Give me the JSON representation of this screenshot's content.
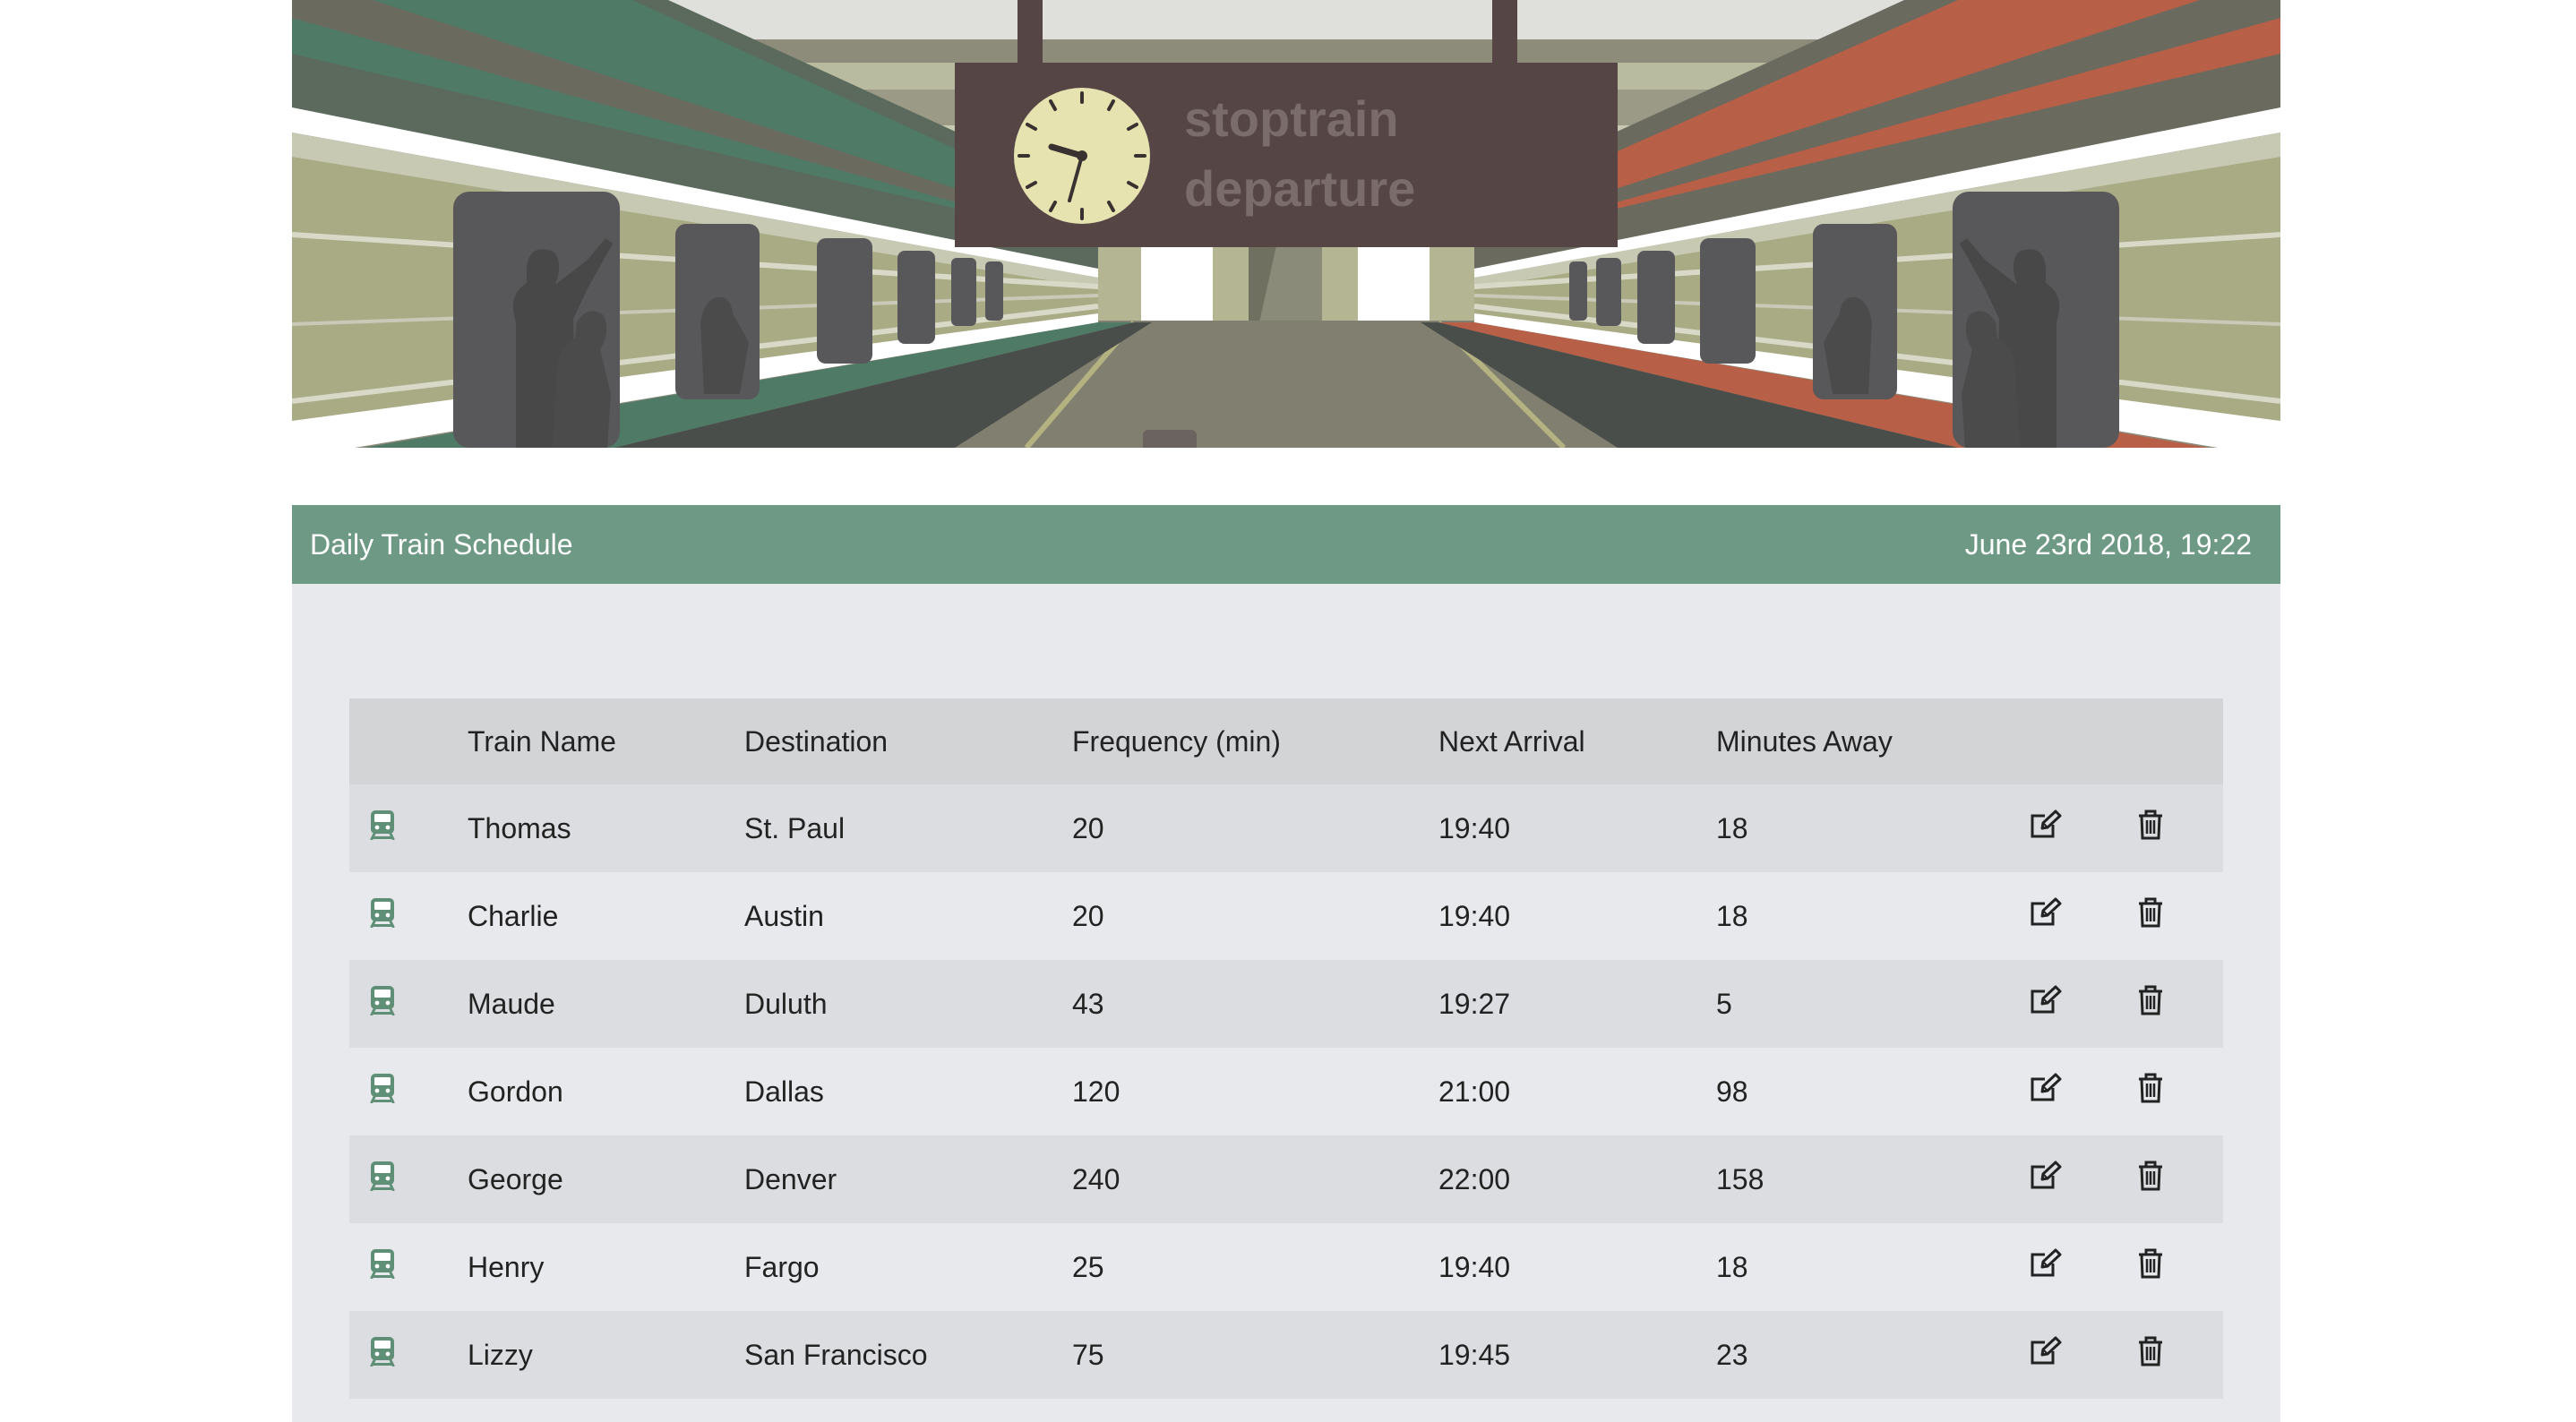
{
  "hero": {
    "sign_line1": "stoptrain",
    "sign_line2": "departure"
  },
  "panel": {
    "title": "Daily Train Schedule",
    "datetime": "June 23rd 2018, 19:22"
  },
  "table": {
    "headers": {
      "name": "Train Name",
      "destination": "Destination",
      "frequency": "Frequency (min)",
      "next_arrival": "Next Arrival",
      "minutes_away": "Minutes Away"
    },
    "row_icon": "train-icon",
    "action_icons": [
      "edit-icon",
      "trash-icon"
    ],
    "rows": [
      {
        "name": "Thomas",
        "destination": "St. Paul",
        "frequency": "20",
        "next_arrival": "19:40",
        "minutes_away": "18"
      },
      {
        "name": "Charlie",
        "destination": "Austin",
        "frequency": "20",
        "next_arrival": "19:40",
        "minutes_away": "18"
      },
      {
        "name": "Maude",
        "destination": "Duluth",
        "frequency": "43",
        "next_arrival": "19:27",
        "minutes_away": "5"
      },
      {
        "name": "Gordon",
        "destination": "Dallas",
        "frequency": "120",
        "next_arrival": "21:00",
        "minutes_away": "98"
      },
      {
        "name": "George",
        "destination": "Denver",
        "frequency": "240",
        "next_arrival": "22:00",
        "minutes_away": "158"
      },
      {
        "name": "Henry",
        "destination": "Fargo",
        "frequency": "25",
        "next_arrival": "19:40",
        "minutes_away": "18"
      },
      {
        "name": "Lizzy",
        "destination": "San Francisco",
        "frequency": "75",
        "next_arrival": "19:45",
        "minutes_away": "23"
      }
    ]
  },
  "colors": {
    "header_green": "#6e9a85",
    "panel_bg": "#e8e9ec",
    "sign_brown": "#554545",
    "train_green": "#4f7a66",
    "train_orange": "#b85f47",
    "train_body": "#a9ab85"
  }
}
